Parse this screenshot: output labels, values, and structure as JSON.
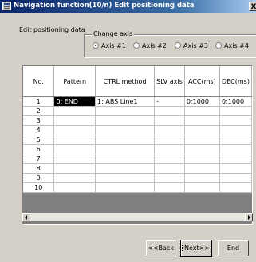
{
  "window": {
    "title": "Navigation function(10/n) Edit positioning data",
    "close_symbol": "X"
  },
  "section_label": "Edit positioning data",
  "change_axis": {
    "label": "Change axis",
    "options": [
      "Axis #1",
      "Axis #2",
      "Axis #3",
      "Axis #4"
    ],
    "selected": "Axis #1"
  },
  "table": {
    "headers": [
      "No.",
      "Pattern",
      "CTRL method",
      "SLV axis",
      "ACC(ms)",
      "DEC(ms)"
    ],
    "rows": [
      [
        "1",
        "0: END",
        "1: ABS Line1",
        "-",
        "0;1000",
        "0;1000"
      ],
      [
        "2",
        "",
        "",
        "",
        "",
        ""
      ],
      [
        "3",
        "",
        "",
        "",
        "",
        ""
      ],
      [
        "4",
        "",
        "",
        "",
        "",
        ""
      ],
      [
        "5",
        "",
        "",
        "",
        "",
        ""
      ],
      [
        "6",
        "",
        "",
        "",
        "",
        ""
      ],
      [
        "7",
        "",
        "",
        "",
        "",
        ""
      ],
      [
        "8",
        "",
        "",
        "",
        "",
        ""
      ],
      [
        "9",
        "",
        "",
        "",
        "",
        ""
      ],
      [
        "10",
        "",
        "",
        "",
        "",
        ""
      ]
    ]
  },
  "buttons": {
    "back": "<<Back",
    "next": "Next>>",
    "end": "End"
  }
}
